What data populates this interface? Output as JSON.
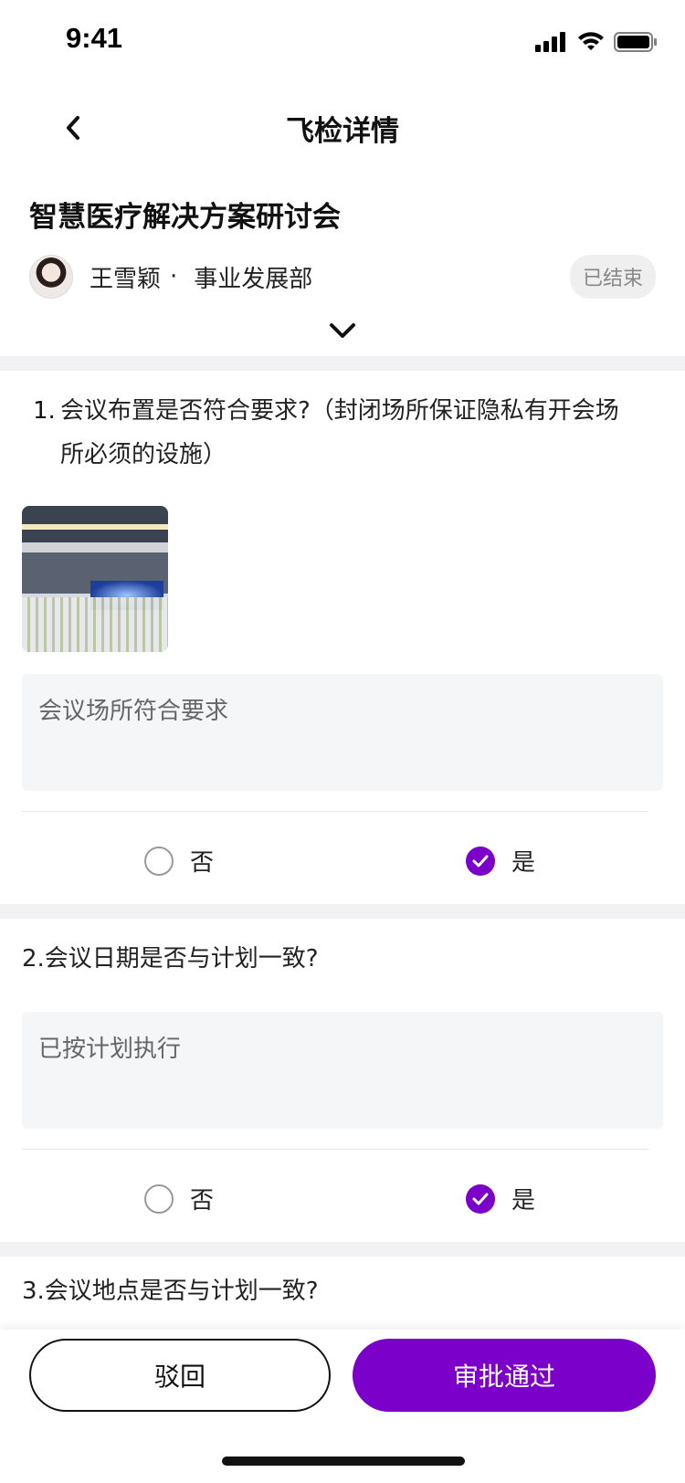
{
  "status_bar": {
    "time": "9:41",
    "icons": [
      "signal-icon",
      "wifi-icon",
      "battery-icon"
    ]
  },
  "nav": {
    "title": "飞检详情",
    "back_icon": "chevron-left-icon"
  },
  "meeting": {
    "title": "智慧医疗解决方案研讨会",
    "owner_name": "王雪颖",
    "separator": "·",
    "department": "事业发展部",
    "status": "已结束",
    "expand_icon": "chevron-down-icon"
  },
  "questions": [
    {
      "number": "1.",
      "text": "会议布置是否符合要求?（封闭场所保证隐私有开会场所必须的设施）",
      "answer": "会议场所符合要求",
      "option_no": "否",
      "option_yes": "是",
      "selected": "yes"
    },
    {
      "text": "2.会议日期是否与计划一致?",
      "answer": "已按计划执行",
      "option_no": "否",
      "option_yes": "是",
      "selected": "yes"
    },
    {
      "text": "3.会议地点是否与计划一致?"
    }
  ],
  "actions": {
    "reject": "驳回",
    "approve": "审批通过"
  },
  "colors": {
    "accent": "#7b00c9",
    "band": "#f2f2f4",
    "input_bg": "#f5f6f8"
  }
}
